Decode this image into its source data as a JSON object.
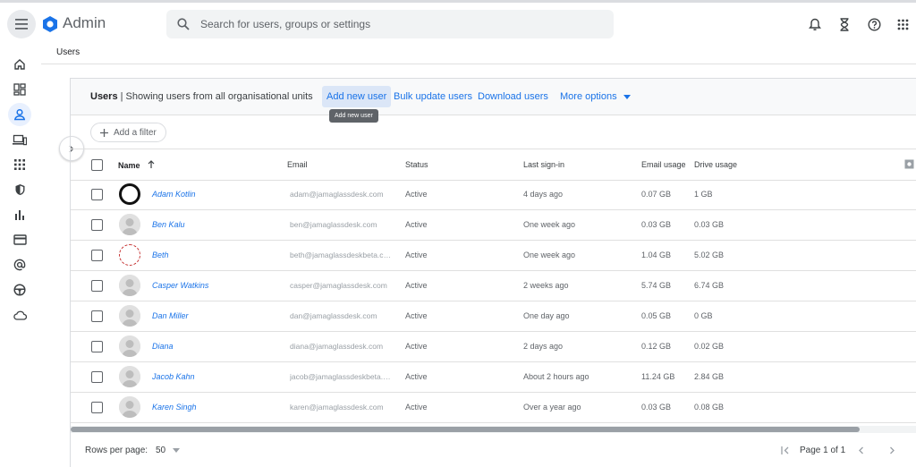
{
  "app": {
    "title": "Admin"
  },
  "search": {
    "placeholder": "Search for users, groups or settings"
  },
  "breadcrumb": "Users",
  "toolbar": {
    "title": "Users",
    "subtitle": " | Showing users from all organisational units",
    "actions": [
      "Add new user",
      "Bulk update users",
      "Download users",
      "More options"
    ],
    "tooltip": "Add new user"
  },
  "filter": {
    "label": "Add a filter"
  },
  "table": {
    "columns": [
      "Name",
      "Email",
      "Status",
      "Last sign-in",
      "Email usage",
      "Drive usage"
    ],
    "rows": [
      {
        "name": "Adam Kotlin",
        "email": "adam@jamaglassdesk.com",
        "status": "Active",
        "last_sign_in": "4 days ago",
        "email_usage": "0.07 GB",
        "drive_usage": "1 GB"
      },
      {
        "name": "Ben Kalu",
        "email": "ben@jamaglassdesk.com",
        "status": "Active",
        "last_sign_in": "One week ago",
        "email_usage": "0.03 GB",
        "drive_usage": "0.03 GB"
      },
      {
        "name": "Beth",
        "email": "beth@jamaglassdeskbeta.com",
        "status": "Active",
        "last_sign_in": "One week ago",
        "email_usage": "1.04 GB",
        "drive_usage": "5.02 GB"
      },
      {
        "name": "Casper Watkins",
        "email": "casper@jamaglassdesk.com",
        "status": "Active",
        "last_sign_in": "2 weeks ago",
        "email_usage": "5.74 GB",
        "drive_usage": "6.74 GB"
      },
      {
        "name": "Dan Miller",
        "email": "dan@jamaglassdesk.com",
        "status": "Active",
        "last_sign_in": "One day ago",
        "email_usage": "0.05 GB",
        "drive_usage": "0 GB"
      },
      {
        "name": "Diana",
        "email": "diana@jamaglassdesk.com",
        "status": "Active",
        "last_sign_in": "2 days ago",
        "email_usage": "0.12 GB",
        "drive_usage": "0.02 GB"
      },
      {
        "name": "Jacob Kahn",
        "email": "jacob@jamaglassdeskbeta.com",
        "status": "Active",
        "last_sign_in": "About 2 hours ago",
        "email_usage": "11.24 GB",
        "drive_usage": "2.84 GB"
      },
      {
        "name": "Karen Singh",
        "email": "karen@jamaglassdesk.com",
        "status": "Active",
        "last_sign_in": "Over a year ago",
        "email_usage": "0.03 GB",
        "drive_usage": "0.08 GB"
      }
    ]
  },
  "pagination": {
    "rows_label": "Rows per page:",
    "rows_value": "50",
    "page_label": "Page 1 of 1"
  },
  "colors": {
    "accent": "#1a73e8",
    "sidebar_active_bg": "#e8f0fe",
    "toolbar_bg": "#f8f9fa"
  },
  "icons": [
    "menu-icon",
    "admin-logo-icon",
    "search-icon",
    "bell-icon",
    "hourglass-icon",
    "help-icon",
    "apps-icon",
    "home-icon",
    "dashboard-icon",
    "user-icon",
    "devices-icon",
    "apps-grid-icon",
    "security-icon",
    "reports-icon",
    "billing-icon",
    "account-at-icon",
    "rules-icon",
    "cloud-icon"
  ]
}
